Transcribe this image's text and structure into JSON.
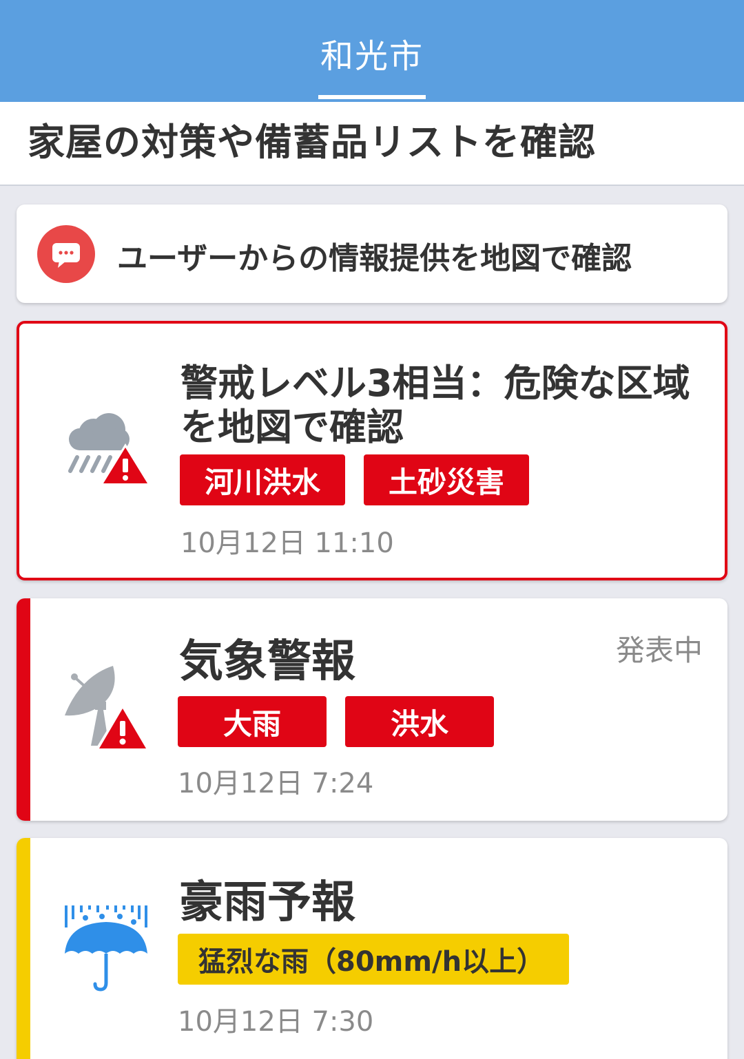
{
  "header": {
    "tab_label": "和光市"
  },
  "subheader": {
    "title": "家屋の対策や備蓄品リストを確認"
  },
  "user_report": {
    "label": "ユーザーからの情報提供を地図で確認",
    "icon": "chat-bubble-icon"
  },
  "alert_card": {
    "title_line1": "警戒レベル3相当：危険な区域",
    "title_line2": "を地図で確認",
    "tags": [
      "河川洪水",
      "土砂災害"
    ],
    "time": "10月12日 11:10",
    "icon": "rain-cloud-warning-icon",
    "color": "#e00515"
  },
  "warning_card": {
    "title": "気象警報",
    "status": "発表中",
    "tags": [
      "大雨",
      "洪水"
    ],
    "time": "10月12日 7:24",
    "icon": "satellite-dish-warning-icon",
    "color": "#e00515"
  },
  "forecast_card": {
    "title": "豪雨予報",
    "tag": "猛烈な雨（80mm/h以上）",
    "time": "10月12日 7:30",
    "icon": "umbrella-rain-icon",
    "color": "#f5cd00"
  }
}
